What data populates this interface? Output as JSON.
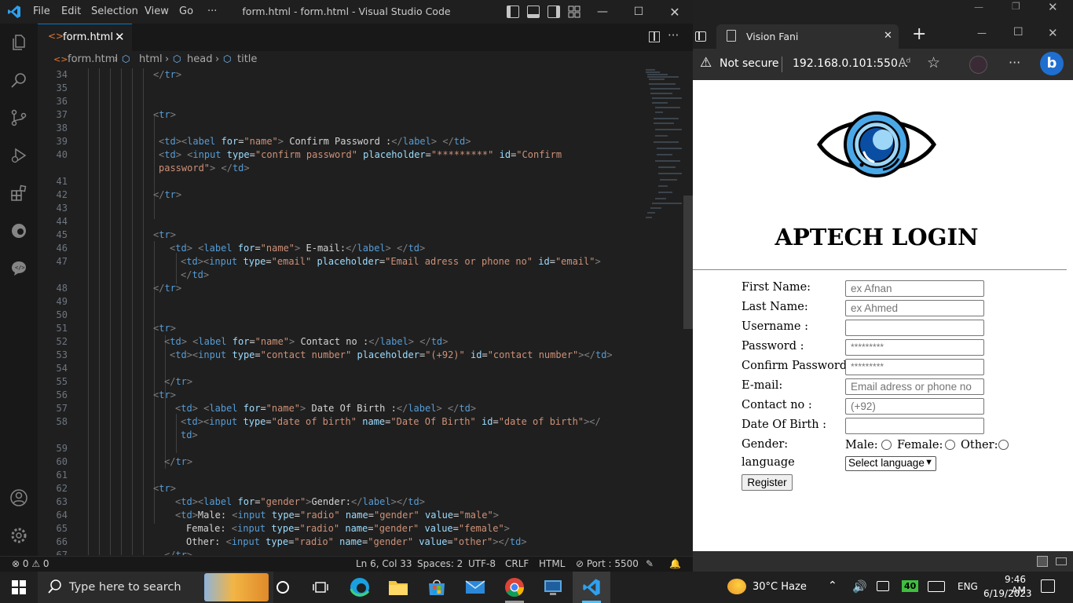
{
  "vscode": {
    "title": "form.html - form.html - Visual Studio Code",
    "menu": [
      "File",
      "Edit",
      "Selection",
      "View",
      "Go",
      "···"
    ],
    "tab_label": "form.html",
    "breadcrumb": [
      "form.html",
      "html",
      "head",
      "title"
    ],
    "status": {
      "problems": "⊗ 0 ⚠ 0",
      "position": "Ln 6, Col 33",
      "spaces": "Spaces: 2",
      "encoding": "UTF-8",
      "eol": "CRLF",
      "language": "HTML",
      "port": "⊘ Port : 5500"
    },
    "line_numbers": [
      "34",
      "35",
      "36",
      "37",
      "38",
      "39",
      "40",
      "41",
      "42",
      "43",
      "44",
      "45",
      "46",
      "47",
      "48",
      "49",
      "50",
      "51",
      "52",
      "53",
      "54",
      "55",
      "56",
      "57",
      "58",
      "59",
      "60",
      "61",
      "62",
      "63",
      "64",
      "65",
      "66",
      "67"
    ]
  },
  "browser": {
    "tab_title": "Vision Fani",
    "not_secure": "Not secure",
    "url": "192.168.0.101:550...",
    "page": {
      "heading": "APTECH LOGIN",
      "fields": [
        {
          "label": "First Name:",
          "placeholder": "ex Afnan"
        },
        {
          "label": "Last Name:",
          "placeholder": "ex Ahmed"
        },
        {
          "label": "Username :",
          "placeholder": ""
        },
        {
          "label": "Password :",
          "placeholder": "*********"
        },
        {
          "label": "Confirm Password :",
          "placeholder": "*********"
        },
        {
          "label": "E-mail:",
          "placeholder": "Email adress or phone no"
        },
        {
          "label": "Contact no :",
          "placeholder": "(+92)"
        },
        {
          "label": "Date Of Birth :",
          "placeholder": ""
        }
      ],
      "gender_label": "Gender:",
      "gender_options": [
        "Male:",
        "Female:",
        "Other:"
      ],
      "language_label": "language",
      "language_select": "Select language",
      "register_button": "Register"
    }
  },
  "taskbar": {
    "search_placeholder": "Type here to search",
    "weather": "30°C  Haze",
    "language": "ENG",
    "time": "9:46 AM",
    "date": "6/19/2023",
    "battery_badge": "40"
  }
}
